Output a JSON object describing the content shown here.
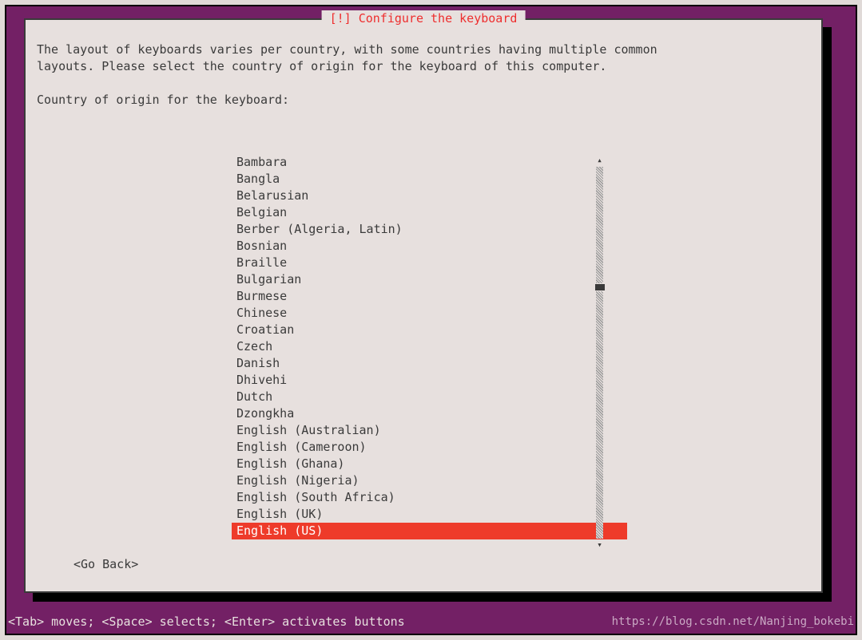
{
  "title": "[!] Configure the keyboard",
  "description": "The layout of keyboards varies per country, with some countries having multiple common\nlayouts. Please select the country of origin for the keyboard of this computer.",
  "prompt": "Country of origin for the keyboard:",
  "items": [
    "Bambara",
    "Bangla",
    "Belarusian",
    "Belgian",
    "Berber (Algeria, Latin)",
    "Bosnian",
    "Braille",
    "Bulgarian",
    "Burmese",
    "Chinese",
    "Croatian",
    "Czech",
    "Danish",
    "Dhivehi",
    "Dutch",
    "Dzongkha",
    "English (Australian)",
    "English (Cameroon)",
    "English (Ghana)",
    "English (Nigeria)",
    "English (South Africa)",
    "English (UK)",
    "English (US)"
  ],
  "selected_index": 22,
  "go_back": "<Go Back>",
  "hint": "<Tab> moves; <Space> selects; <Enter> activates buttons",
  "watermark": "https://blog.csdn.net/Nanjing_bokebi"
}
